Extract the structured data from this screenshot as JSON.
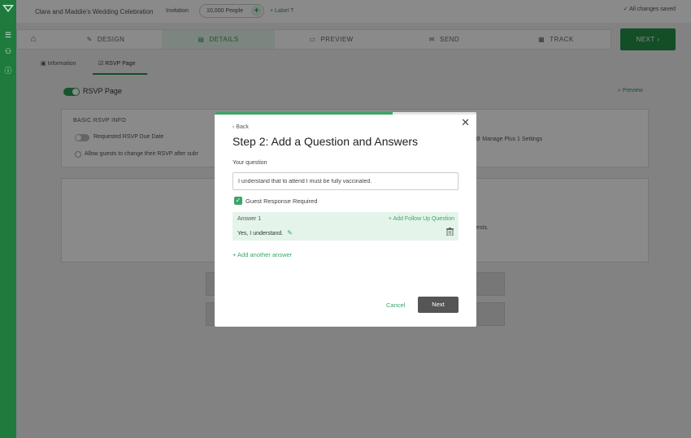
{
  "header": {
    "event_title": "Clara and Maddie's Wedding Celebration",
    "doc_type": "Invitation",
    "people_count": "10,000 People",
    "add_label": "+ Label",
    "save_status": "All changes saved"
  },
  "steps": [
    {
      "label": "DESIGN",
      "icon": "brush-icon"
    },
    {
      "label": "DETAILS",
      "icon": "document-icon"
    },
    {
      "label": "PREVIEW",
      "icon": "monitor-icon"
    },
    {
      "label": "SEND",
      "icon": "envelope-icon"
    },
    {
      "label": "TRACK",
      "icon": "chart-icon"
    }
  ],
  "active_step": "DETAILS",
  "next_button": "NEXT",
  "subtabs": [
    "Information",
    "RSVP Page"
  ],
  "active_subtab": "RSVP Page",
  "rsvp": {
    "page_label": "RSVP Page",
    "page_enabled": true,
    "preview_link": "Preview",
    "basic_info_label": "BASIC RSVP INFO",
    "due_date_label": "Requested RSVP Due Date",
    "allow_change_label": "Allow guests to change their RSVP after subr",
    "manage_plus_label": "Manage Plus 1 Settings",
    "partial_text": "ests."
  },
  "modal": {
    "progress": 0.68,
    "back_label": "Back",
    "title": "Step 2: Add a Question and Answers",
    "question_label": "Your question",
    "question_value": "I understand that to attend I must be fully vaccinated.",
    "required_label": "Guest Response Required",
    "required_checked": true,
    "answers": [
      {
        "label": "Answer 1",
        "value": "Yes, I understand.",
        "followup_label": "+ Add Follow Up Question"
      }
    ],
    "add_answer_label": "+ Add another answer",
    "cancel_label": "Cancel",
    "next_label": "Next"
  },
  "colors": {
    "brand_green": "#239049",
    "accent_green": "#3aa568",
    "rail_green": "#1f7a3e"
  }
}
